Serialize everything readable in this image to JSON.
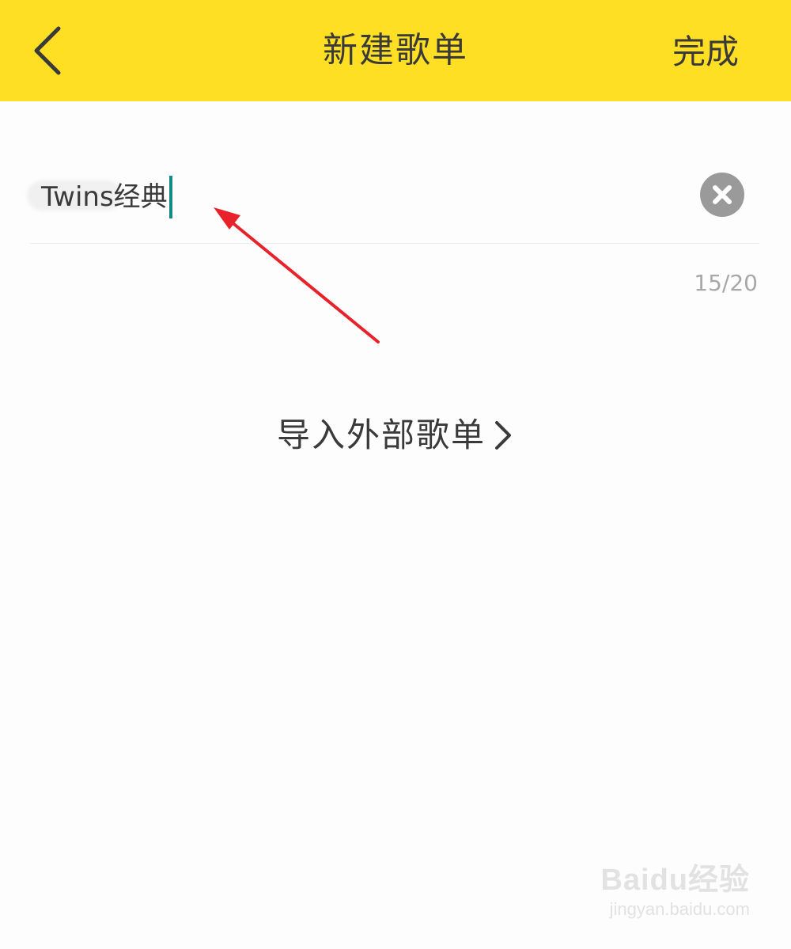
{
  "header": {
    "title": "新建歌单",
    "done_label": "完成"
  },
  "playlist_name": {
    "value": "Twins经典",
    "counter": "15/20"
  },
  "import": {
    "label": "导入外部歌单"
  },
  "watermark": {
    "logo": "Baidu经验",
    "url": "jingyan.baidu.com"
  },
  "colors": {
    "header_bg": "#ffdf24",
    "caret": "#148c86",
    "annotation_arrow": "#e8222a",
    "clear_button": "#9a9a9a"
  },
  "icons": {
    "back": "chevron-left-icon",
    "clear": "close-circle-icon",
    "import_arrow": "chevron-right-icon"
  }
}
